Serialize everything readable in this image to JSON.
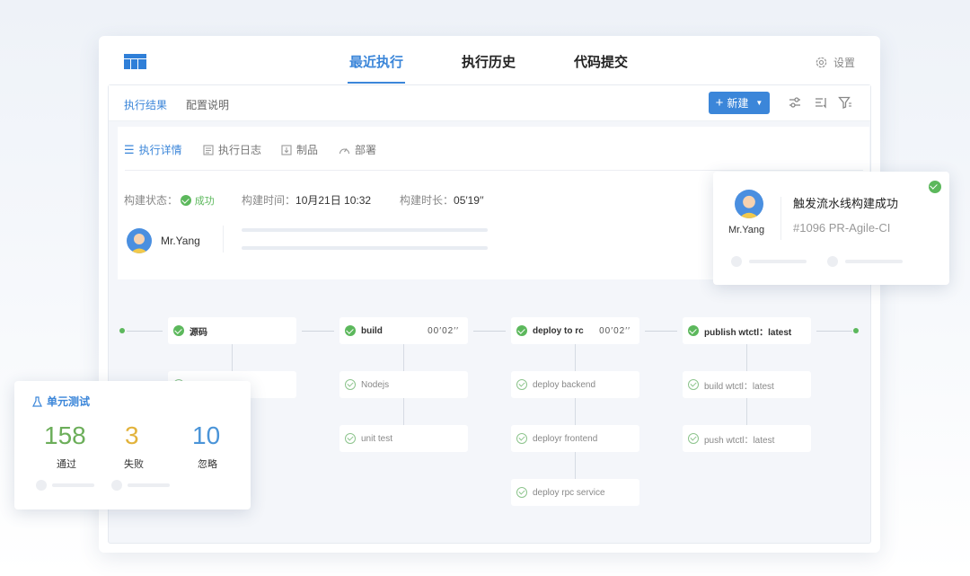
{
  "header": {
    "tabs": [
      {
        "label": "最近执行",
        "active": true
      },
      {
        "label": "执行历史",
        "active": false
      },
      {
        "label": "代码提交",
        "active": false
      }
    ],
    "settings_label": "设置"
  },
  "subbar": {
    "tabs": [
      {
        "label": "执行结果",
        "active": true
      },
      {
        "label": "配置说明",
        "active": false
      }
    ],
    "new_button": "新建"
  },
  "detail": {
    "tabs": [
      {
        "label": "执行详情",
        "icon": "list-icon",
        "active": true
      },
      {
        "label": "执行日志",
        "icon": "log-icon",
        "active": false
      },
      {
        "label": "制品",
        "icon": "artifact-icon",
        "active": false
      },
      {
        "label": "部署",
        "icon": "deploy-gauge-icon",
        "active": false
      }
    ],
    "status_label": "构建状态：",
    "status_value": "成功",
    "time_label": "构建时间：",
    "time_value": "10月21日 10:32",
    "duration_label": "构建时长：",
    "duration_value": "05′19′′",
    "user": "Mr.Yang"
  },
  "pipeline": {
    "stages": [
      {
        "name": "源码",
        "time": "",
        "jobs": [
          ""
        ]
      },
      {
        "name": "build",
        "time": "00′02′′",
        "jobs": [
          "Nodejs",
          "unit test"
        ]
      },
      {
        "name": "deploy to rc",
        "time": "00′02′′",
        "jobs": [
          "deploy backend",
          "deployr frontend",
          "deploy rpc service"
        ]
      },
      {
        "name": "publish wtctl：latest",
        "time": "",
        "jobs": [
          "build wtctl：latest",
          "push wtctl：latest"
        ]
      }
    ]
  },
  "notification": {
    "user": "Mr.Yang",
    "title": "触发流水线构建成功",
    "subtitle": "#1096 PR-Agile-CI"
  },
  "test_card": {
    "title": "单元测试",
    "stats": [
      {
        "value": "158",
        "label": "通过",
        "color": "#6cae5a"
      },
      {
        "value": "3",
        "label": "失败",
        "color": "#e2b33c"
      },
      {
        "value": "10",
        "label": "忽略",
        "color": "#4a94d8"
      }
    ]
  },
  "colors": {
    "accent": "#3b86d9",
    "success": "#5cb85c"
  }
}
